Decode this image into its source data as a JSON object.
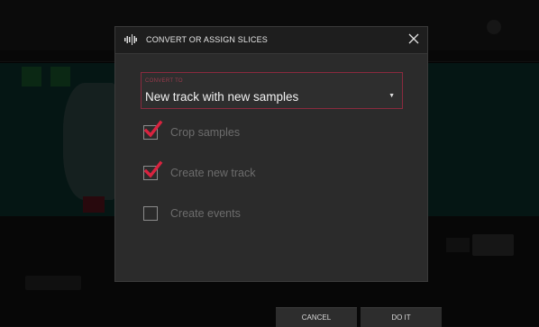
{
  "dialog": {
    "title": "CONVERT OR ASSIGN SLICES",
    "convert_to": {
      "label": "CONVERT TO",
      "value": "New track with new samples"
    },
    "options": [
      {
        "label": "Crop samples",
        "checked": true
      },
      {
        "label": "Create new track",
        "checked": true
      },
      {
        "label": "Create events",
        "checked": false
      }
    ]
  },
  "footer": {
    "cancel_label": "CANCEL",
    "doit_label": "DO IT"
  },
  "colors": {
    "accent": "#c8203c",
    "dialog_bg": "#2b2b2b",
    "header_bg": "#1e1e1e"
  }
}
